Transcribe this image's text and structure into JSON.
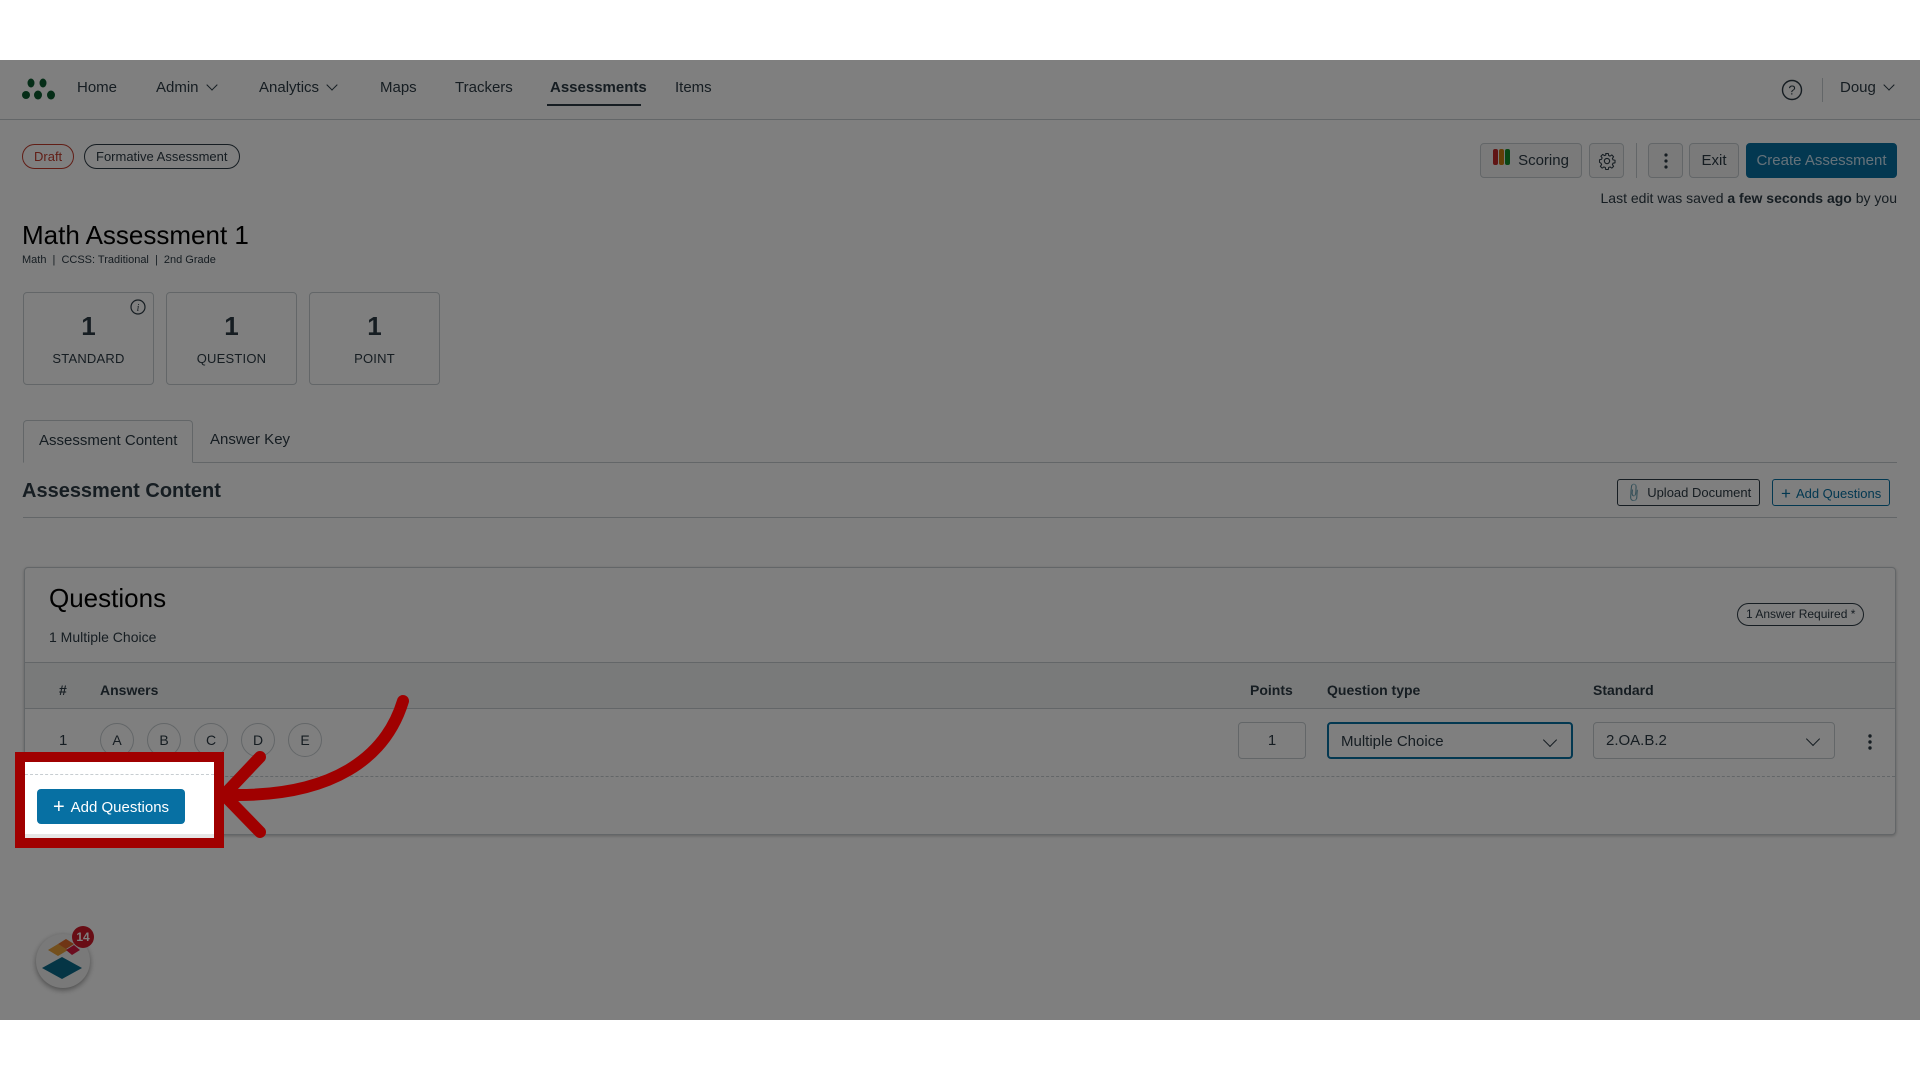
{
  "nav": {
    "items": [
      {
        "label": "Home"
      },
      {
        "label": "Admin",
        "has_dropdown": true
      },
      {
        "label": "Analytics",
        "has_dropdown": true
      },
      {
        "label": "Maps"
      },
      {
        "label": "Trackers"
      },
      {
        "label": "Assessments",
        "active": true
      },
      {
        "label": "Items"
      }
    ],
    "help_icon": "question-circle-icon",
    "user": "Doug"
  },
  "header": {
    "status_badge": "Draft",
    "type_badge": "Formative Assessment",
    "title": "Math Assessment 1",
    "meta": [
      "Math",
      "CCSS: Traditional",
      "2nd Grade"
    ],
    "toolbar": {
      "scoring": "Scoring",
      "settings_icon": "gear-icon",
      "more_icon": "kebab-icon",
      "exit": "Exit",
      "create": "Create Assessment"
    },
    "last_edit_prefix": "Last edit was saved",
    "last_edit_time": "a few seconds ago",
    "last_edit_suffix": "by you"
  },
  "stats": [
    {
      "value": "1",
      "label": "STANDARD",
      "has_info": true
    },
    {
      "value": "1",
      "label": "QUESTION"
    },
    {
      "value": "1",
      "label": "POINT"
    }
  ],
  "tabs": [
    {
      "label": "Assessment Content",
      "active": true
    },
    {
      "label": "Answer Key"
    }
  ],
  "content": {
    "heading": "Assessment Content",
    "upload_button": "Upload Document",
    "add_button": "Add Questions"
  },
  "questions": {
    "title": "Questions",
    "summary": "1 Multiple Choice",
    "required_badge": "1 Answer Required *",
    "columns": {
      "num": "#",
      "answers": "Answers",
      "points": "Points",
      "type": "Question type",
      "standard": "Standard"
    },
    "rows": [
      {
        "num": "1",
        "choices": [
          "A",
          "B",
          "C",
          "D",
          "E"
        ],
        "points": "1",
        "type": "Multiple Choice",
        "standard": "2.OA.B.2"
      }
    ],
    "add_button": "Add Questions"
  },
  "widget": {
    "badge_count": "14"
  },
  "colors": {
    "accent_blue": "#0770a3",
    "draft_red": "#c23c2d",
    "annotation_red": "#a00000",
    "logo_green": "#0b5b2e"
  }
}
